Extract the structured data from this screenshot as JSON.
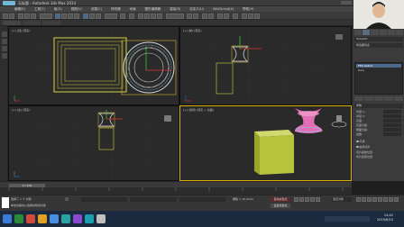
{
  "title_bar": {
    "app_title": "无标题 - Autodesk 3ds Max 2014"
  },
  "menu": {
    "items": [
      "编辑(E)",
      "工具(T)",
      "组(G)",
      "视图(V)",
      "创建(C)",
      "修改器",
      "动画",
      "图形编辑器",
      "渲染(R)",
      "自定义(U)",
      "MAXScript(X)",
      "帮助(H)"
    ]
  },
  "viewports": {
    "top": "[+] [顶] [真实]",
    "front": "[+] [前] [真实]",
    "left": "[+] [左] [真实]",
    "perspective": "[+] [透视] [真实 + 边面]"
  },
  "command_panel": {
    "object_name": "Tube001",
    "modifier_list_label": "修改器列表",
    "stack": [
      "FFD 4x4x4",
      "Tube"
    ],
    "params": [
      "参数",
      "半径 1:",
      "半径 2:",
      "高度:",
      "高度分段:",
      "端面分段:",
      "边数:"
    ],
    "options": [
      "平滑",
      "启用切片",
      "切片起始位置:",
      "切片结束位置:"
    ]
  },
  "timeline": {
    "frame": "0 / 100"
  },
  "status": {
    "selection": "选择了 1 个 对象",
    "hint": "单击并拖动以选择并移动对象",
    "grid": "栅格 = 10.0mm",
    "auto_key": "自动关键点",
    "set_key": "设置关键点",
    "selected_label": "选定对象"
  },
  "clock": {
    "time": "14:42",
    "date": "2019/6/10"
  },
  "colors": {
    "yellow_mesh": "#b8c23a",
    "pink_mesh": "#e26fb3",
    "blue_selection": "#7fd0ff",
    "taskbar": "#1b2a3e"
  }
}
